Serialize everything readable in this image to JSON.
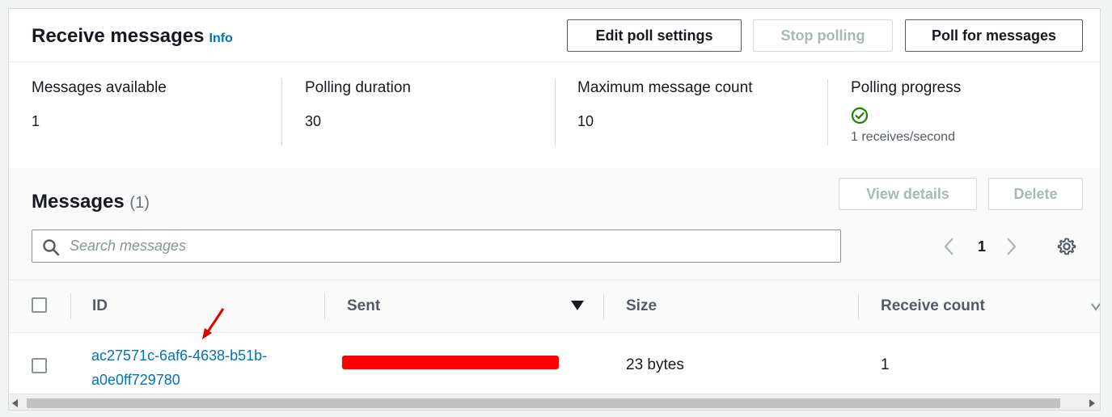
{
  "header": {
    "title": "Receive messages",
    "info_label": "Info",
    "buttons": {
      "edit_poll_settings": "Edit poll settings",
      "stop_polling": "Stop polling",
      "poll_for_messages": "Poll for messages"
    }
  },
  "stats": {
    "messages_available": {
      "label": "Messages available",
      "value": "1"
    },
    "polling_duration": {
      "label": "Polling duration",
      "value": "30"
    },
    "max_message_count": {
      "label": "Maximum message count",
      "value": "10"
    },
    "polling_progress": {
      "label": "Polling progress",
      "value": "1 receives/second",
      "status_color": "#1d8102"
    }
  },
  "messages": {
    "title": "Messages",
    "count": "(1)",
    "view_details_label": "View details",
    "delete_label": "Delete",
    "search": {
      "placeholder": "Search messages",
      "value": ""
    },
    "pagination": {
      "current_page": "1"
    },
    "columns": [
      "ID",
      "Sent",
      "Size",
      "Receive count"
    ],
    "rows": [
      {
        "id_line1": "ac27571c-6af6-4638-b51b-",
        "id_line2": "a0e0ff729780",
        "sent": "",
        "size": "23 bytes",
        "receive_count": "1"
      }
    ]
  },
  "icons": [
    "search-icon",
    "chevron-left-icon",
    "chevron-right-icon",
    "gear-icon",
    "sort-descending-icon",
    "check-circle-icon",
    "annotation-arrow-icon"
  ],
  "colors": {
    "link": "#0073bb",
    "redaction": "#ff0000",
    "annotation": "#e00000"
  }
}
